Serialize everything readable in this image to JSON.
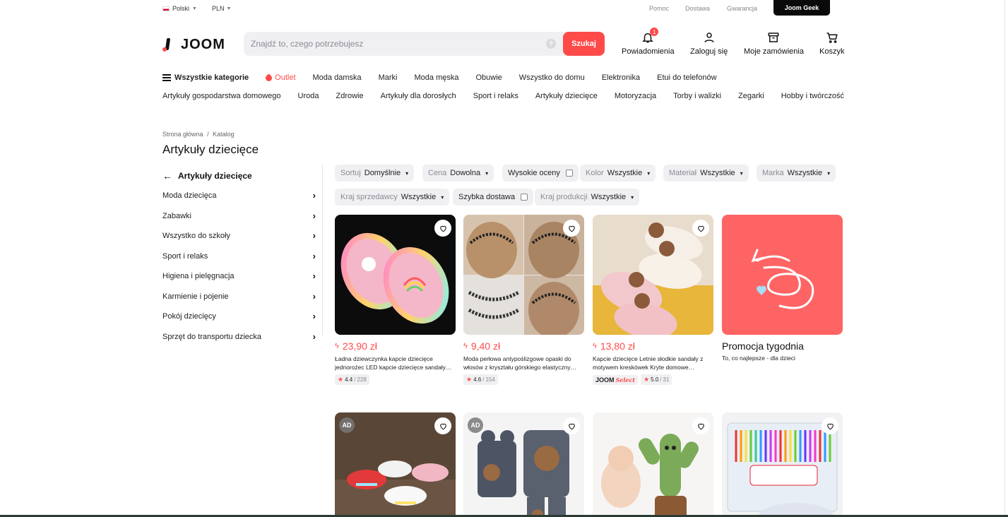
{
  "topbar": {
    "language": "Polski",
    "currency": "PLN",
    "links": [
      "Pomoc",
      "Dostawa",
      "Gwarancja"
    ],
    "geek": "Joom Geek"
  },
  "header": {
    "logo": "JOOM",
    "search_placeholder": "Znajdź to, czego potrzebujesz",
    "search_help": "?",
    "search_button": "Szukaj",
    "notifications": {
      "label": "Powiadomienia",
      "badge": "1"
    },
    "login": "Zaloguj się",
    "orders": "Moje zamówienia",
    "cart": "Koszyk"
  },
  "nav": {
    "all_categories": "Wszystkie kategorie",
    "outlet": "Outlet",
    "row1": [
      "Moda damska",
      "Marki",
      "Moda męska",
      "Obuwie",
      "Wszystko do domu",
      "Elektronika",
      "Etui do telefonów"
    ],
    "row2": [
      "Artykuły gospodarstwa domowego",
      "Uroda",
      "Zdrowie",
      "Artykuły dla dorosłych",
      "Sport i relaks",
      "Artykuły dziecięce",
      "Motoryzacja",
      "Torby i walizki",
      "Zegarki",
      "Hobby i twórczość"
    ]
  },
  "breadcrumb": {
    "home": "Strona główna",
    "sep": "/",
    "catalog": "Katalog"
  },
  "page_title": "Artykuły dziecięce",
  "sidebar": {
    "back_label": "Artykuły dziecięce",
    "items": [
      "Moda dziecięca",
      "Zabawki",
      "Wszystko do szkoły",
      "Sport i relaks",
      "Higiena i pielęgnacja",
      "Karmienie i pojenie",
      "Pokój dziecięcy",
      "Sprzęt do transportu dziecka"
    ]
  },
  "filters": {
    "sort": {
      "label": "Sortuj",
      "value": "Domyślnie"
    },
    "price": {
      "label": "Cena",
      "value": "Dowolna"
    },
    "high_rating": "Wysokie oceny",
    "color": {
      "label": "Kolor",
      "value": "Wszystkie"
    },
    "material": {
      "label": "Materiał",
      "value": "Wszystkie"
    },
    "brand": {
      "label": "Marka",
      "value": "Wszystkie"
    },
    "seller_country": {
      "label": "Kraj sprzedawcy",
      "value": "Wszystkie"
    },
    "fast_delivery": "Szybka dostawa",
    "production_country": {
      "label": "Kraj produkcji",
      "value": "Wszystkie"
    }
  },
  "products": [
    {
      "price": "23,90 zł",
      "desc": "Ładna dziewczynka kapcie dziecięce jednorożec LED kapcie dziecięce sandały…",
      "rating": "4.4",
      "reviews": "228"
    },
    {
      "price": "9,40 zł",
      "desc": "Moda perłowa antypoślizgowe opaski do włosów z kryształu górskiego elastyczny…",
      "rating": "4.6",
      "reviews": "154"
    },
    {
      "price": "13,80 zł",
      "desc": "Kapcie dziecięce Letnie słodkie sandały z motywem kreskówek Kryte domowe…",
      "rating": "5.0",
      "reviews": "31",
      "badge": "JOOM",
      "badge_select": "Select"
    }
  ],
  "promo": {
    "title": "Promocja tygodnia",
    "subtitle": "To, co najlepsze - dla dzieci"
  },
  "row2_ad": "AD",
  "colors": {
    "accent": "#ff4a4a",
    "chip": "#f0f0f3",
    "geek": "#0a0a0a"
  }
}
